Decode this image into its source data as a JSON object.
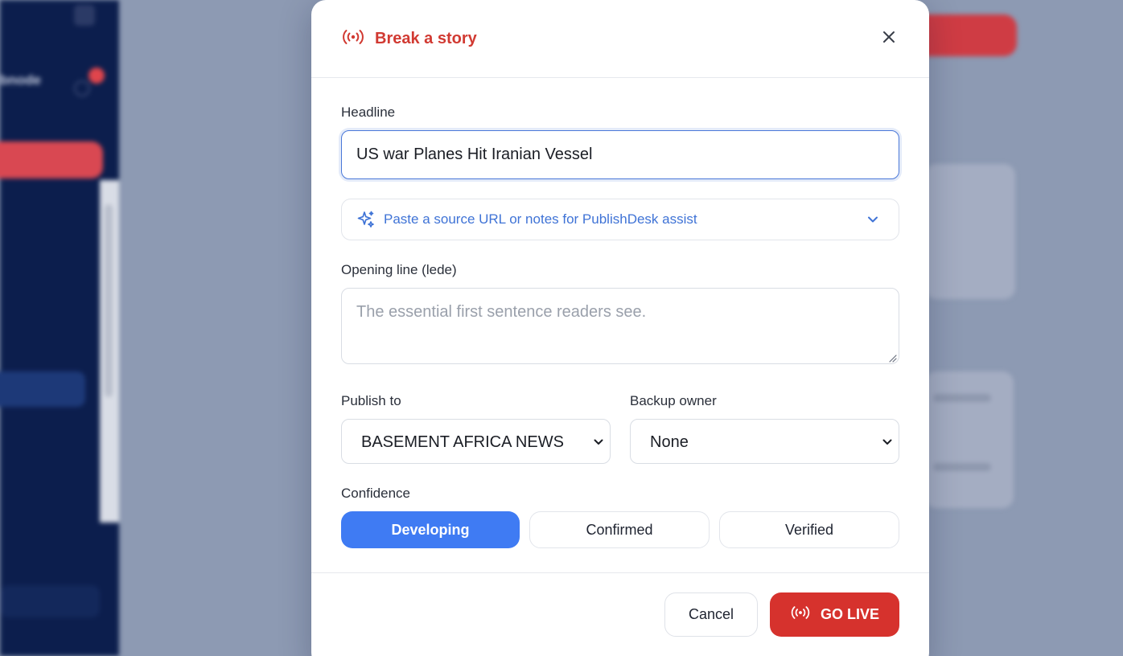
{
  "colors": {
    "accent_red": "#d6322d",
    "title_red": "#d13a32",
    "accent_blue": "#3f7bf3",
    "link_blue": "#3f73d6",
    "backdrop": "#8d9ab3",
    "sidebar": "#0c1e4d"
  },
  "background": {
    "sidebar_brand": "bnode"
  },
  "dialog": {
    "title": "Break a story",
    "title_icon": "broadcast-icon",
    "close_icon": "close-icon",
    "headline": {
      "label": "Headline",
      "value": "US war Planes Hit Iranian Vessel"
    },
    "assist": {
      "icon": "sparkle-icon",
      "text": "Paste a source URL or notes for PublishDesk assist",
      "chevron": "chevron-down-icon"
    },
    "lede": {
      "label": "Opening line (lede)",
      "placeholder": "The essential first sentence readers see.",
      "value": ""
    },
    "publish_to": {
      "label": "Publish to",
      "selected": "BASEMENT AFRICA NEWS"
    },
    "backup_owner": {
      "label": "Backup owner",
      "selected": "None"
    },
    "confidence": {
      "label": "Confidence",
      "options": [
        "Developing",
        "Confirmed",
        "Verified"
      ],
      "selected": "Developing"
    },
    "footer": {
      "cancel_label": "Cancel",
      "go_live_label": "GO LIVE",
      "go_live_icon": "broadcast-icon"
    }
  }
}
